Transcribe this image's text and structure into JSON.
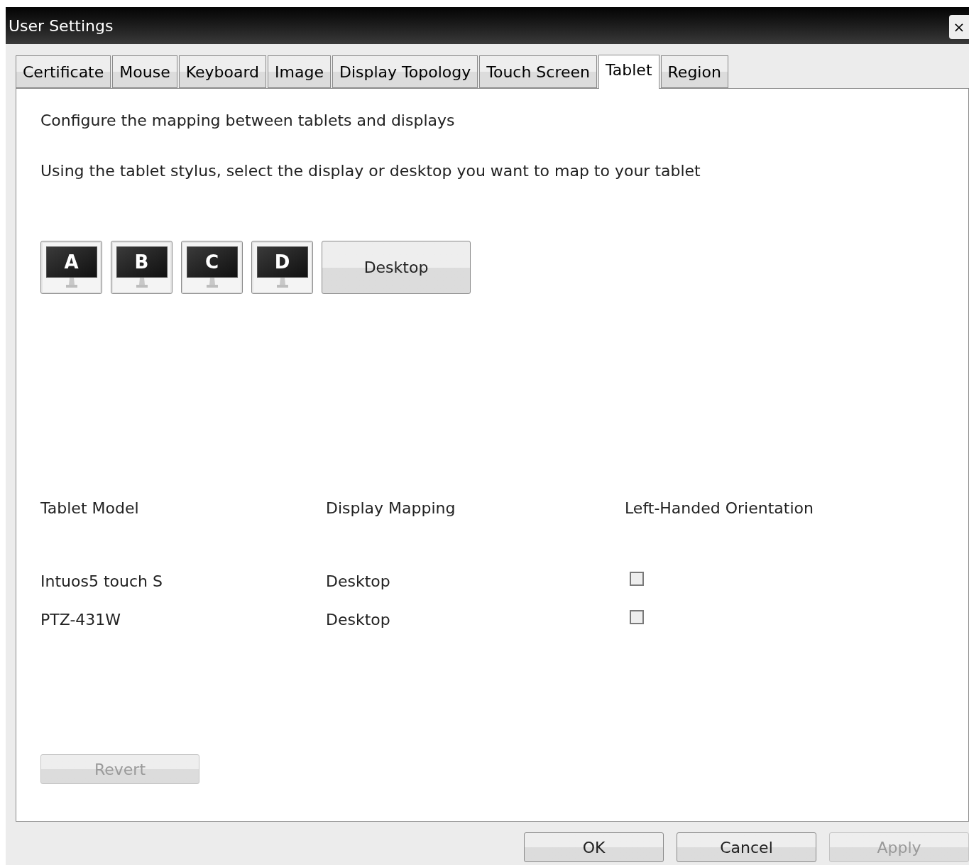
{
  "window": {
    "title": "User Settings",
    "close": "×"
  },
  "tabs": [
    {
      "label": "Certificate",
      "selected": false
    },
    {
      "label": "Mouse",
      "selected": false
    },
    {
      "label": "Keyboard",
      "selected": false
    },
    {
      "label": "Image",
      "selected": false
    },
    {
      "label": "Display Topology",
      "selected": false
    },
    {
      "label": "Touch Screen",
      "selected": false
    },
    {
      "label": "Tablet",
      "selected": true
    },
    {
      "label": "Region",
      "selected": false
    }
  ],
  "intro": "Configure the mapping between tablets and displays",
  "instruction": "Using the tablet stylus, select the display or desktop you want to map to your tablet",
  "targets": [
    {
      "kind": "monitor",
      "label": "A"
    },
    {
      "kind": "monitor",
      "label": "B"
    },
    {
      "kind": "monitor",
      "label": "C"
    },
    {
      "kind": "monitor",
      "label": "D"
    },
    {
      "kind": "desktop",
      "label": "Desktop"
    }
  ],
  "table": {
    "columns": [
      "Tablet Model",
      "Display Mapping",
      "Left-Handed Orientation"
    ],
    "rows": [
      {
        "model": "Intuos5 touch S",
        "mapping": "Desktop",
        "left_handed": false
      },
      {
        "model": "PTZ-431W",
        "mapping": "Desktop",
        "left_handed": false
      }
    ]
  },
  "revert": {
    "label": "Revert",
    "disabled": true
  },
  "buttons": [
    {
      "label": "OK",
      "disabled": false
    },
    {
      "label": "Cancel",
      "disabled": false
    },
    {
      "label": "Apply",
      "disabled": true
    }
  ]
}
